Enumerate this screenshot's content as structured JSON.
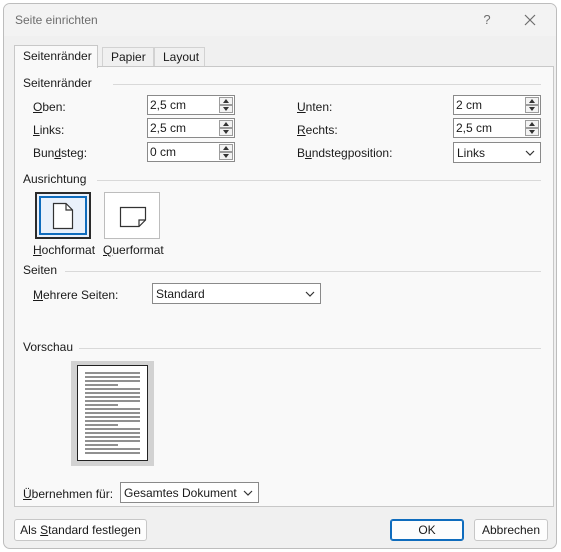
{
  "window": {
    "title": "Seite einrichten",
    "help_label": "?"
  },
  "tabs": [
    {
      "label": "Seitenränder",
      "active": true
    },
    {
      "label": "Papier",
      "active": false
    },
    {
      "label": "Layout",
      "active": false
    }
  ],
  "margins": {
    "section_label": "Seitenränder",
    "top": {
      "label_mnemonic": "O",
      "label_rest": "ben:",
      "value": "2,5 cm"
    },
    "left": {
      "label_mnemonic": "L",
      "label_rest": "inks:",
      "value": "2,5 cm"
    },
    "gutter": {
      "label_pre": "Bun",
      "label_mnemonic": "d",
      "label_rest": "steg:",
      "value": "0 cm"
    },
    "bottom": {
      "label_mnemonic": "U",
      "label_rest": "nten:",
      "value": "2 cm"
    },
    "right": {
      "label_mnemonic": "R",
      "label_rest": "echts:",
      "value": "2,5 cm"
    },
    "gutter_position": {
      "label_pre": "B",
      "label_mnemonic": "u",
      "label_rest": "ndstegposition:",
      "value": "Links"
    }
  },
  "orientation": {
    "section_label": "Ausrichtung",
    "portrait": {
      "label_mnemonic": "H",
      "label_rest": "ochformat",
      "selected": true,
      "icon": "portrait-page-icon"
    },
    "landscape": {
      "label_mnemonic": "Q",
      "label_rest": "uerformat",
      "selected": false,
      "icon": "landscape-page-icon"
    }
  },
  "pages": {
    "section_label": "Seiten",
    "multiple": {
      "label_mnemonic": "M",
      "label_rest": "ehrere Seiten:",
      "value": "Standard"
    }
  },
  "preview": {
    "section_label": "Vorschau"
  },
  "apply_to": {
    "label_mnemonic": "Ü",
    "label_rest": "bernehmen für:",
    "value": "Gesamtes Dokument"
  },
  "footer": {
    "default_pre": "Als ",
    "default_mnemonic": "S",
    "default_rest": "tandard festlegen",
    "ok_label": "OK",
    "cancel_label": "Abbrechen"
  },
  "colors": {
    "accent": "#0f6cbd",
    "dialog_bg": "#f0f0f0",
    "panel_bg": "#f9f9f9"
  }
}
